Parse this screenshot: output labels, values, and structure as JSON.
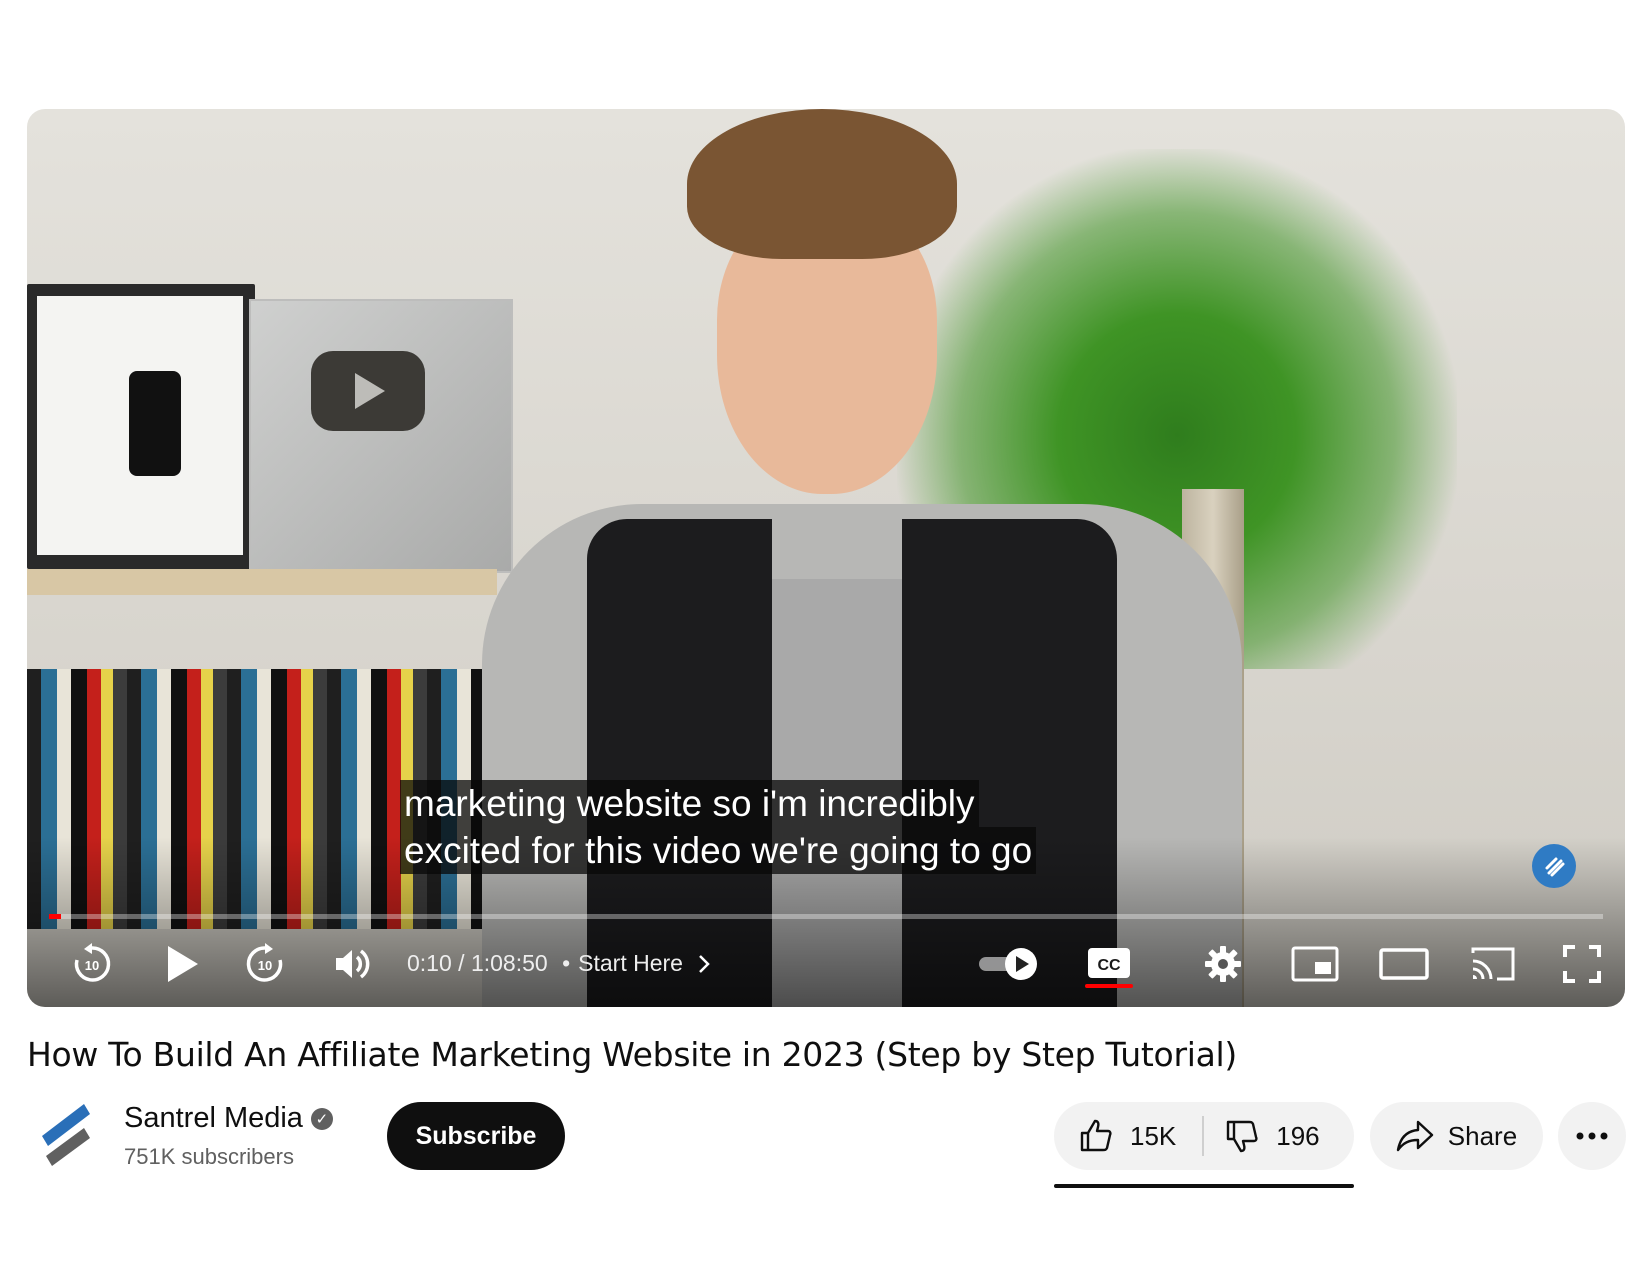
{
  "player": {
    "caption_lines": [
      "marketing website so i'm incredibly",
      "excited for this video we're going to go"
    ],
    "current_time": "0:10",
    "duration": "1:08:50",
    "time_separator": "/",
    "chapter_dot": "•",
    "chapter": "Start Here",
    "progress_fraction": 0.0024,
    "seek_seconds_label": "10",
    "captions_enabled": true,
    "accent_color": "#ff0000"
  },
  "video": {
    "title": "How To Build An Affiliate Marketing Website in 2023 (Step by Step Tutorial)"
  },
  "channel": {
    "name": "Santrel Media",
    "verified_glyph": "✓",
    "subscribers": "751K subscribers",
    "subscribe_label": "Subscribe"
  },
  "actions": {
    "likes": "15K",
    "dislikes": "196",
    "share_label": "Share",
    "more_glyph": "⋯"
  },
  "icons": {
    "rewind": "rewind-10-icon",
    "play": "play-icon",
    "forward": "forward-10-icon",
    "volume": "volume-icon",
    "autoplay": "autoplay-toggle-icon",
    "captions": "captions-icon",
    "settings": "gear-icon",
    "miniplayer": "miniplayer-icon",
    "theater": "theater-mode-icon",
    "cast": "cast-icon",
    "fullscreen": "fullscreen-icon",
    "like": "thumbs-up-icon",
    "dislike": "thumbs-down-icon",
    "share": "share-arrow-icon"
  }
}
